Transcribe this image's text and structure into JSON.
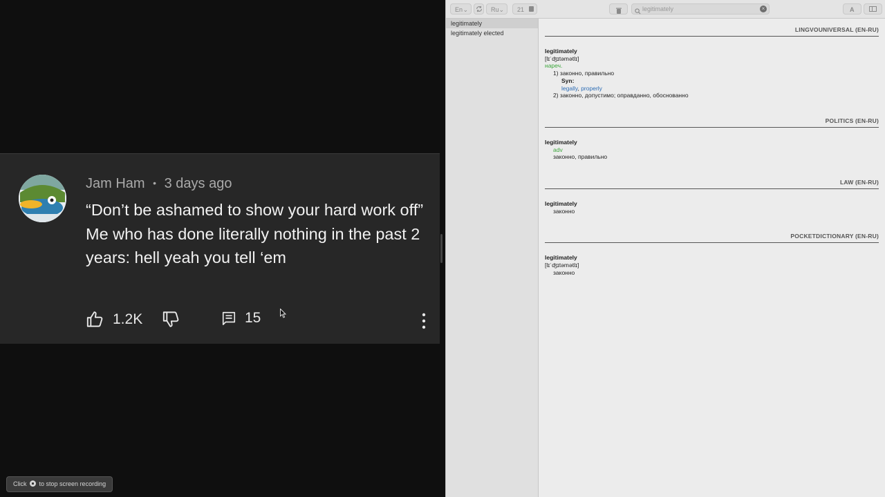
{
  "comment": {
    "author": "Jam Ham",
    "separator": "•",
    "time": "3 days ago",
    "lines": [
      "“Don’t be ashamed to show your hard work off”",
      "Me who has done literally nothing in the past 2 years: hell yeah you tell ‘em"
    ],
    "likes": "1.2K",
    "replies": "15",
    "icons": [
      "thumbs-up-icon",
      "thumbs-down-icon",
      "reply-icon",
      "more-icon"
    ]
  },
  "recording": {
    "text_before": "Click",
    "text_after": "to stop screen recording"
  },
  "dict": {
    "toolbar": {
      "from_lang": "En",
      "to_lang": "Ru",
      "font_size": "21",
      "search_placeholder": "legitimately",
      "font_btn": "A"
    },
    "sidebar": [
      "legitimately",
      "legitimately elected"
    ],
    "sections": [
      {
        "title": "LINGVOUNIVERSAL (EN-RU)",
        "word": "legitimately",
        "transcription": "[lɪˈʤɪtəmətlɪ]",
        "pos": "нареч.",
        "sense1": "1) законно, правильно",
        "syn_label": "Syn:",
        "syn1": "legally",
        "syn_sep": ", ",
        "syn2": "properly",
        "sense2": "2) законно, допустимо; оправданно, обоснованно"
      },
      {
        "title": "POLITICS (EN-RU)",
        "word": "legitimately",
        "pos": "adv",
        "translation": "законно, правильно"
      },
      {
        "title": "LAW (EN-RU)",
        "word": "legitimately",
        "translation": "законно"
      },
      {
        "title": "POCKETDICTIONARY (EN-RU)",
        "word": "legitimately",
        "transcription": "[lɪˈʤɪtəmətlɪ]",
        "translation": "законно"
      }
    ]
  }
}
